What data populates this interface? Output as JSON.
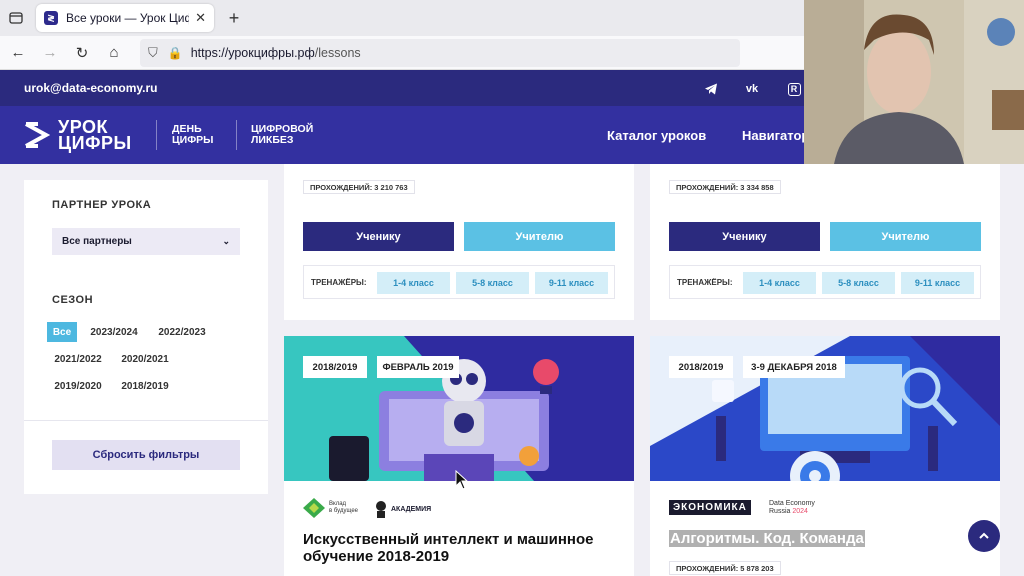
{
  "browser": {
    "tab_title": "Все уроки — Урок Цифры",
    "url_host": "https://урокцифры.рф",
    "url_path": "/lessons"
  },
  "site": {
    "email": "urok@data-economy.ru",
    "logo_line1": "УРОК",
    "logo_line2": "ЦИФРЫ",
    "sublogo1_line1": "ДЕНЬ",
    "sublogo1_line2": "ЦИФРЫ",
    "sublogo2_line1": "ЦИФРОВОЙ",
    "sublogo2_line2": "ЛИКБЕЗ",
    "menu": [
      "Каталог уроков",
      "Навигатор"
    ]
  },
  "sidebar": {
    "partner_label": "ПАРТНЕР УРОКА",
    "partner_value": "Все партнеры",
    "season_label": "СЕЗОН",
    "seasons": [
      "Все",
      "2023/2024",
      "2022/2023",
      "2021/2022",
      "2020/2021",
      "2019/2020",
      "2018/2019"
    ],
    "reset_label": "Сбросить фильтры"
  },
  "cards_top": [
    {
      "passes": "ПРОХОЖДЕНИЙ: 3 210 763",
      "student": "Ученику",
      "teacher": "Учителю",
      "trainers_label": "ТРЕНАЖЁРЫ:",
      "grades": [
        "1-4 класс",
        "5-8 класс",
        "9-11 класс"
      ]
    },
    {
      "passes": "ПРОХОЖДЕНИЙ: 3 334 858",
      "student": "Ученику",
      "teacher": "Учителю",
      "trainers_label": "ТРЕНАЖЁРЫ:",
      "grades": [
        "1-4 класс",
        "5-8 класс",
        "9-11 класс"
      ]
    }
  ],
  "cards_bottom": [
    {
      "season": "2018/2019",
      "date": "ФЕВРАЛЬ 2019",
      "partner1_line1": "Вклад",
      "partner1_line2": "в будущее",
      "partner2": "АКАДЕМИЯ",
      "title": "Искусственный интеллект и машинное обучение 2018-2019"
    },
    {
      "season": "2018/2019",
      "date": "3-9 ДЕКАБРЯ 2018",
      "partner1": "ЭКОНОМИКА",
      "partner2_line1": "Data Economy",
      "partner2_line2": "Russia",
      "partner2_year": "2024",
      "title": "Алгоритмы. Код. Команда",
      "passes": "ПРОХОЖДЕНИЙ: 5 878 203"
    }
  ],
  "colors": {
    "brand_dark": "#2b2a7e",
    "brand": "#3330a0",
    "accent_blue": "#5bc1e4",
    "teal": "#37c6c0"
  }
}
